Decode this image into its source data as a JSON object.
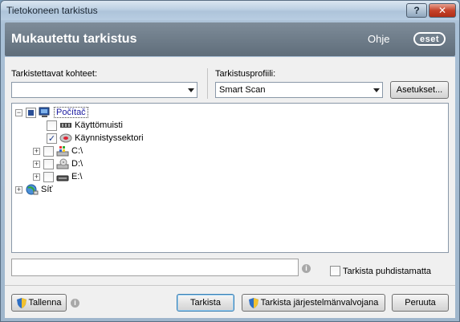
{
  "window": {
    "title": "Tietokoneen tarkistus",
    "help_btn": "?",
    "close_btn": "✕"
  },
  "header": {
    "title": "Mukautettu tarkistus",
    "help_link": "Ohje",
    "logo_text": "eset"
  },
  "targets": {
    "label": "Tarkistettavat kohteet:",
    "value": ""
  },
  "profile": {
    "label": "Tarkistusprofiili:",
    "value": "Smart Scan",
    "settings_button": "Asetukset..."
  },
  "tree": {
    "root": {
      "label": "Počítač",
      "state": "partial",
      "icon": "computer-icon"
    },
    "items": [
      {
        "label": "Käyttömuisti",
        "checked": false,
        "expandable": false,
        "icon": "memory-icon"
      },
      {
        "label": "Käynnistyssektori",
        "checked": true,
        "expandable": false,
        "icon": "boot-sector-icon"
      },
      {
        "label": "C:\\",
        "checked": false,
        "expandable": true,
        "icon": "windows-drive-icon"
      },
      {
        "label": "D:\\",
        "checked": false,
        "expandable": true,
        "icon": "cd-drive-icon"
      },
      {
        "label": "E:\\",
        "checked": false,
        "expandable": true,
        "icon": "removable-drive-icon"
      }
    ],
    "network": {
      "label": "Síť",
      "icon": "network-icon"
    }
  },
  "path_input": {
    "value": ""
  },
  "no_clean": {
    "label": "Tarkista puhdistamatta",
    "checked": false
  },
  "footer": {
    "save_button": "Tallenna",
    "scan_button": "Tarkista",
    "admin_scan_button": "Tarkista järjestelmänvalvojana",
    "cancel_button": "Peruuta"
  },
  "colors": {
    "header_bg": "#6d7b88",
    "close_red": "#c5432b"
  }
}
